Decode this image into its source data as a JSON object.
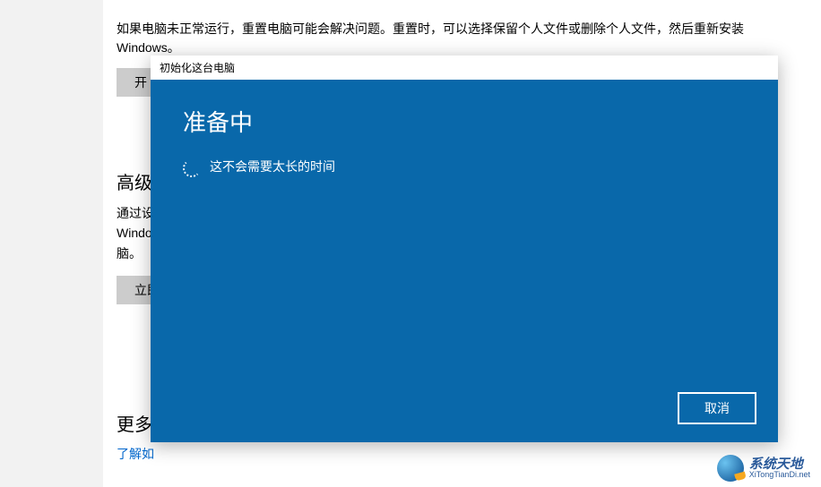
{
  "page": {
    "reset_description": "如果电脑未正常运行，重置电脑可能会解决问题。重置时，可以选择保留个人文件或删除个人文件，然后重新安装 Windows。",
    "reset_button_partial": "开",
    "advanced_title_partial": "高级",
    "advanced_desc_line1": "通过设",
    "advanced_desc_line2": "Windo",
    "advanced_desc_line3": "脑。",
    "advanced_button_partial": "立即",
    "more_title_partial": "更多",
    "more_link_partial": "了解如"
  },
  "dialog": {
    "title": "初始化这台电脑",
    "heading": "准备中",
    "status_text": "这不会需要太长的时间",
    "cancel_label": "取消"
  },
  "watermark": {
    "main": "系统天地",
    "sub": "XiTongTianDi.net"
  }
}
